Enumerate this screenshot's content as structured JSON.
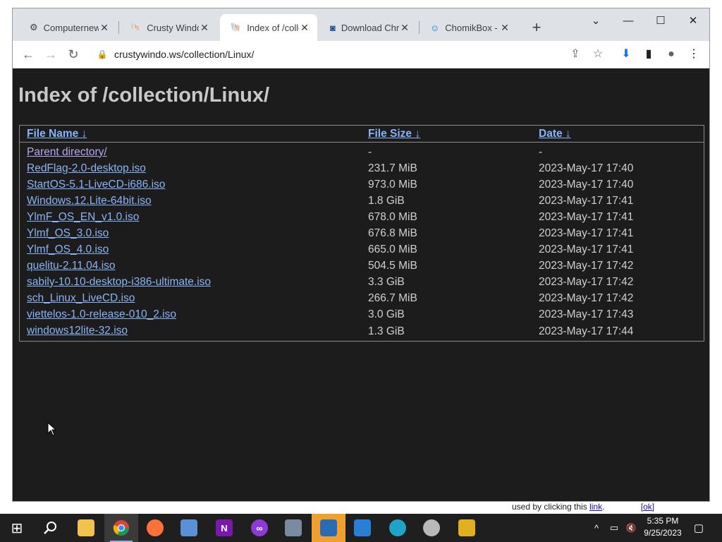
{
  "browser": {
    "tabs": [
      {
        "title": "Computernewb",
        "close": "✕",
        "active": false
      },
      {
        "title": "Crusty Windows",
        "close": "✕",
        "active": false
      },
      {
        "title": "Index of /collection",
        "close": "✕",
        "active": true
      },
      {
        "title": "Download Chro",
        "close": "✕",
        "active": false
      },
      {
        "title": "ChomikBox - So",
        "close": "✕",
        "active": false
      }
    ],
    "new_tab": "+",
    "window_controls": {
      "tab_search": "⌄",
      "minimize": "—",
      "maximize": "☐",
      "close": "✕"
    },
    "nav": {
      "back": "←",
      "forward": "→",
      "reload": "↻"
    },
    "url": "crustywindo.ws/collection/Linux/",
    "toolbar_icons": {
      "share": "⇪",
      "bookmark": "☆",
      "download": "⬇",
      "sidepanel": "▮",
      "profile": "●",
      "menu": "⋮"
    }
  },
  "page": {
    "title": "Index of /collection/Linux/",
    "columns": [
      {
        "label": "File Name",
        "sort": "↓"
      },
      {
        "label": "File Size",
        "sort": "↓"
      },
      {
        "label": "Date",
        "sort": "↓"
      }
    ],
    "parent": {
      "name": "Parent directory/",
      "size": "-",
      "date": "-"
    },
    "files": [
      {
        "name": "RedFlag-2.0-desktop.iso",
        "size": "231.7 MiB",
        "date": "2023-May-17 17:40"
      },
      {
        "name": "StartOS-5.1-LiveCD-i686.iso",
        "size": "973.0 MiB",
        "date": "2023-May-17 17:40"
      },
      {
        "name": "Windows.12.Lite-64bit.iso",
        "size": "1.8 GiB",
        "date": "2023-May-17 17:41"
      },
      {
        "name": "YlmF_OS_EN_v1.0.iso",
        "size": "678.0 MiB",
        "date": "2023-May-17 17:41"
      },
      {
        "name": "Ylmf_OS_3.0.iso",
        "size": "676.8 MiB",
        "date": "2023-May-17 17:41"
      },
      {
        "name": "Ylmf_OS_4.0.iso",
        "size": "665.0 MiB",
        "date": "2023-May-17 17:41"
      },
      {
        "name": "quelitu-2.11.04.iso",
        "size": "504.5 MiB",
        "date": "2023-May-17 17:42"
      },
      {
        "name": "sabily-10.10-desktop-i386-ultimate.iso",
        "size": "3.3 GiB",
        "date": "2023-May-17 17:42"
      },
      {
        "name": "sch_Linux_LiveCD.iso",
        "size": "266.7 MiB",
        "date": "2023-May-17 17:42"
      },
      {
        "name": "viettelos-1.0-release-010_2.iso",
        "size": "3.0 GiB",
        "date": "2023-May-17 17:43"
      },
      {
        "name": "windows12lite-32.iso",
        "size": "1.3 GiB",
        "date": "2023-May-17 17:44"
      }
    ],
    "cookie_bar": {
      "text": "used by clicking this",
      "link": "link",
      "period": ".",
      "ok": "[ok]"
    }
  },
  "taskbar": {
    "start": "⊞",
    "search": "⚲",
    "apps": [
      "file-explorer",
      "chrome",
      "firefox",
      "control-panel",
      "onenote",
      "mixed-reality",
      "network-tool",
      "folder-app",
      "people",
      "edge",
      "dvd-player",
      "archive-tool"
    ],
    "clock": {
      "time": "5:35 PM",
      "date": "9/25/2023"
    },
    "tray": {
      "chevron": "^",
      "network": "▭",
      "volume": "🔇",
      "notifications": "▢"
    }
  }
}
